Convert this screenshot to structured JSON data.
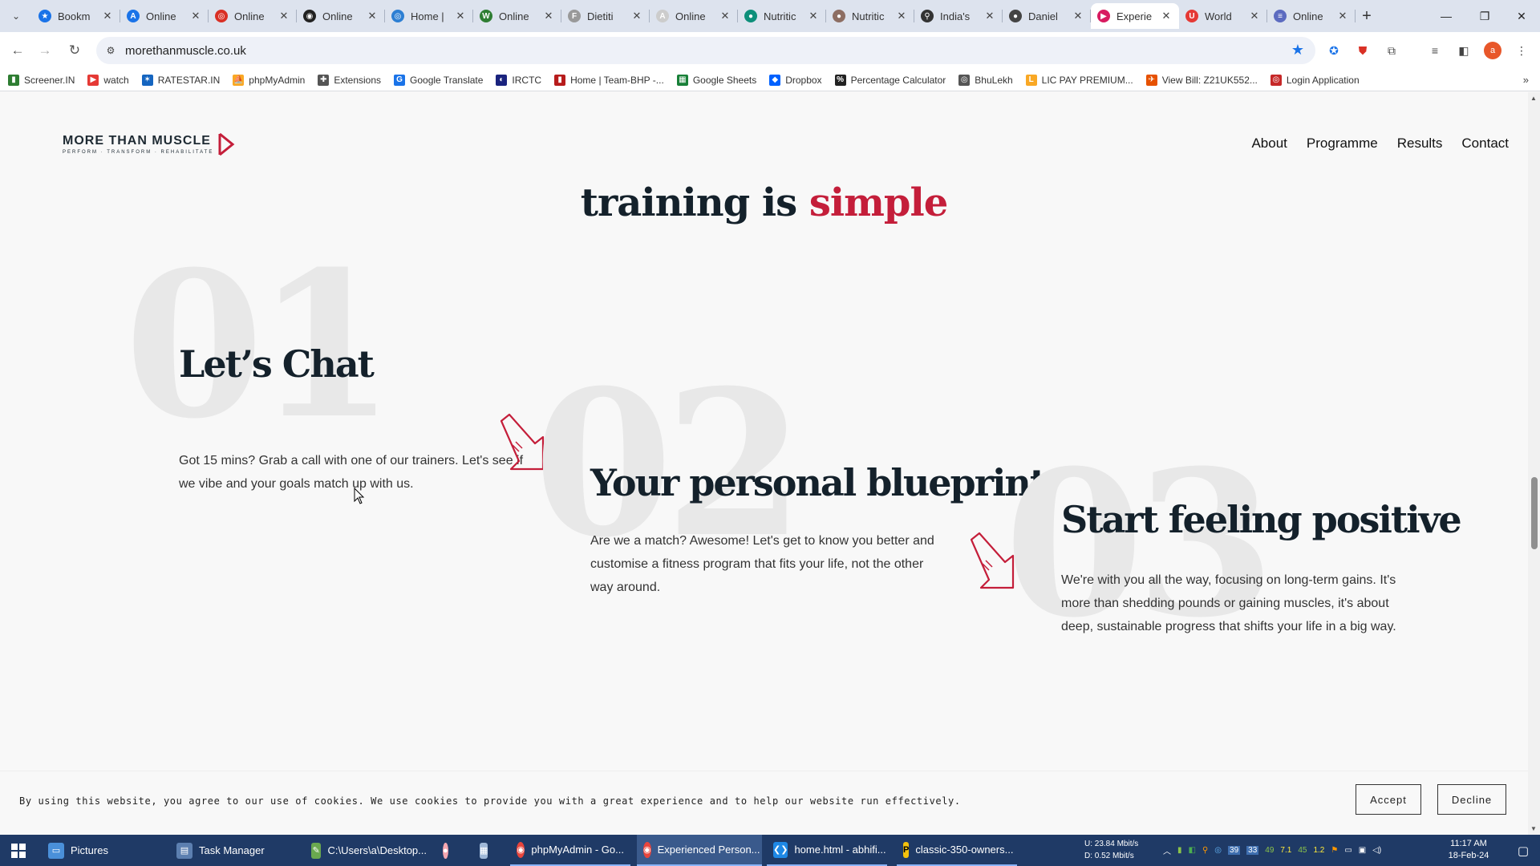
{
  "browser": {
    "tabs": [
      {
        "title": "Bookm",
        "fav_color": "#1a73e8",
        "fav_glyph": "★"
      },
      {
        "title": "Online",
        "fav_color": "#1a73e8",
        "fav_glyph": "A"
      },
      {
        "title": "Online",
        "fav_color": "#d93025",
        "fav_glyph": "◎"
      },
      {
        "title": "Online",
        "fav_color": "#222222",
        "fav_glyph": "◉"
      },
      {
        "title": "Home |",
        "fav_color": "#2d7fd3",
        "fav_glyph": "◎"
      },
      {
        "title": "Online",
        "fav_color": "#2e7d32",
        "fav_glyph": "W"
      },
      {
        "title": "Dietiti",
        "fav_color": "#999999",
        "fav_glyph": "F"
      },
      {
        "title": "Online",
        "fav_color": "#cccccc",
        "fav_glyph": "A"
      },
      {
        "title": "Nutritic",
        "fav_color": "#0d8f7a",
        "fav_glyph": "●"
      },
      {
        "title": "Nutritic",
        "fav_color": "#8d6e63",
        "fav_glyph": "●"
      },
      {
        "title": "India's",
        "fav_color": "#333333",
        "fav_glyph": "⚲"
      },
      {
        "title": "Daniel",
        "fav_color": "#444444",
        "fav_glyph": "●"
      },
      {
        "title": "Experie",
        "fav_color": "#d81b60",
        "fav_glyph": "▶",
        "active": true
      },
      {
        "title": "World",
        "fav_color": "#e53935",
        "fav_glyph": "U"
      },
      {
        "title": "Online",
        "fav_color": "#5c6bc0",
        "fav_glyph": "≡"
      }
    ],
    "url": "morethanmuscle.co.uk",
    "bookmarks": [
      {
        "label": "Screener.IN",
        "color": "#2e7d32",
        "glyph": "▮"
      },
      {
        "label": "watch",
        "color": "#e53935",
        "glyph": "▶"
      },
      {
        "label": "RATESTAR.IN",
        "color": "#1565c0",
        "glyph": "✶"
      },
      {
        "label": "phpMyAdmin",
        "color": "#f9a825",
        "glyph": "⛵"
      },
      {
        "label": "Extensions",
        "color": "#555555",
        "glyph": "✚"
      },
      {
        "label": "Google Translate",
        "color": "#1a73e8",
        "glyph": "G"
      },
      {
        "label": "IRCTC",
        "color": "#1a237e",
        "glyph": "◐"
      },
      {
        "label": "Home | Team-BHP -...",
        "color": "#b71c1c",
        "glyph": "▮"
      },
      {
        "label": "Google Sheets",
        "color": "#188038",
        "glyph": "▦"
      },
      {
        "label": "Dropbox",
        "color": "#0061fe",
        "glyph": "◆"
      },
      {
        "label": "Percentage Calculator",
        "color": "#222222",
        "glyph": "%"
      },
      {
        "label": "BhuLekh",
        "color": "#555555",
        "glyph": "◎"
      },
      {
        "label": "LIC PAY PREMIUM...",
        "color": "#f9a825",
        "glyph": "L"
      },
      {
        "label": "View Bill: Z21UK552...",
        "color": "#e65100",
        "glyph": "✈"
      },
      {
        "label": "Login Application",
        "color": "#c62828",
        "glyph": "◎"
      }
    ]
  },
  "site": {
    "logo_main": "MORE THAN MUSCLE",
    "logo_sub": "PERFORM · TRANSFORM · REHABILITATE",
    "nav": [
      "About",
      "Programme",
      "Results",
      "Contact"
    ],
    "headline_pre": "training is ",
    "headline_accent": "simple",
    "accent_color": "#c41e3a",
    "steps": [
      {
        "num": "01",
        "title": "Let’s Chat",
        "body": "Got 15 mins? Grab a call with one of our trainers. Let's see if we vibe and your goals match up with us."
      },
      {
        "num": "02",
        "title": "Your personal blueprint",
        "body": "Are we a match? Awesome! Let's get to know you better and customise a fitness program that fits your life, not the other way around."
      },
      {
        "num": "03",
        "title": "Start feeling positive",
        "body": "We're with you all the way, focusing on long-term gains. It's more than shedding pounds or gaining muscles, it's about deep, sustainable progress that shifts your life in a big way."
      }
    ]
  },
  "cookie": {
    "text": "By using this website, you agree to our use of cookies. We use cookies to provide you with a great experience and to help our website run effectively.",
    "accept": "Accept",
    "decline": "Decline"
  },
  "taskbar": {
    "items": [
      "Pictures",
      "Task Manager",
      "C:\\Users\\a\\Desktop...",
      "phpMyAdmin - Go...",
      "Experienced Person...",
      "home.html - abhifi...",
      "classic-350-owners..."
    ],
    "net_up": "U:",
    "net_up_val": "23.84 Mbit/s",
    "net_down": "D:",
    "net_down_val": "0.52 Mbit/s",
    "tray_nums": [
      "39",
      "33",
      "49",
      "7.1",
      "45",
      "1.2"
    ],
    "time": "11:17 AM",
    "date": "18-Feb-24"
  }
}
